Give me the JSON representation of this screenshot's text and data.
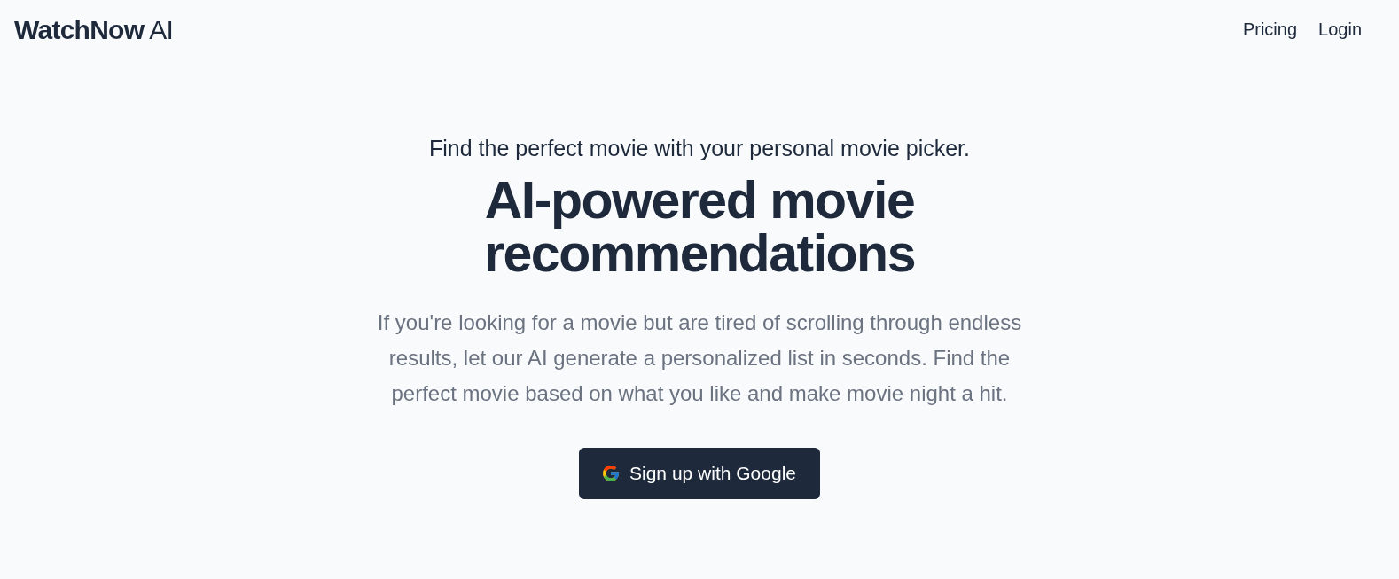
{
  "header": {
    "logo": "**WatchNow** AI",
    "nav": [
      {
        "label": "Pricing"
      },
      {
        "label": "Login"
      }
    ]
  },
  "hero": {
    "tagline": "Find the perfect movie with your personal movie picker.",
    "heading": "AI-powered movie recommendations",
    "description": "If you're looking for a movie but are tired of scrolling through endless results, let our AI generate a personalized list in seconds. Find the perfect movie based on what you like and make movie night a hit.",
    "cta": {
      "label": "Sign up with Google"
    }
  }
}
